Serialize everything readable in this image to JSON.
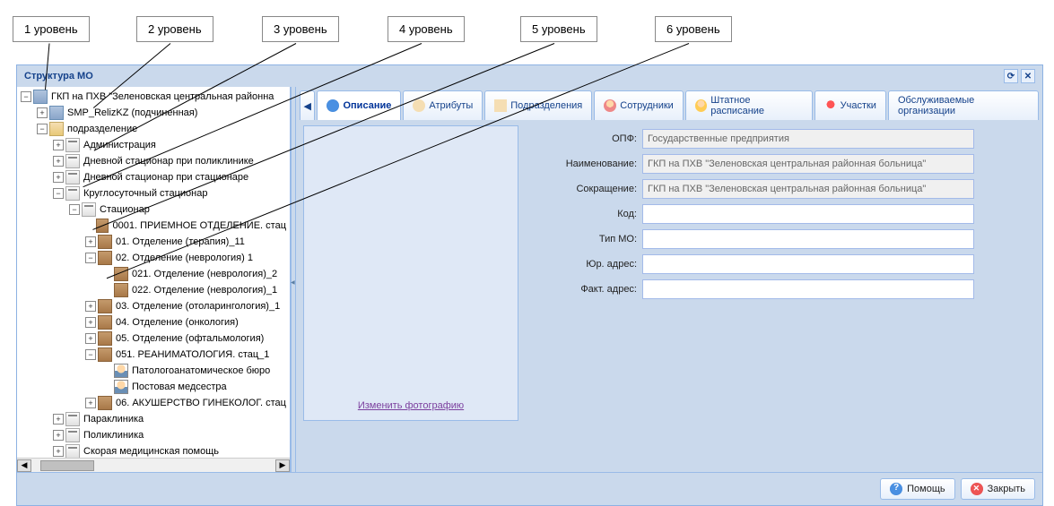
{
  "callouts": {
    "level1": "1 уровень",
    "level2": "2 уровень",
    "level3": "3 уровень",
    "level4": "4 уровень",
    "level5": "5 уровень",
    "level6": "6 уровень"
  },
  "window": {
    "title": "Структура МО"
  },
  "tree": {
    "root": "ГКП на ПХВ \"Зеленовская центральная районна",
    "items": [
      {
        "label": "SMP_RelizKZ (подчиненная)",
        "indent": 1,
        "icon": "building",
        "toggle": "+"
      },
      {
        "label": "подразделение",
        "indent": 1,
        "icon": "folder",
        "toggle": "-"
      },
      {
        "label": "Администрация",
        "indent": 2,
        "icon": "doc",
        "toggle": "+"
      },
      {
        "label": "Дневной стационар при поликлинике",
        "indent": 2,
        "icon": "doc",
        "toggle": "+"
      },
      {
        "label": "Дневной стационар при стационаре",
        "indent": 2,
        "icon": "doc",
        "toggle": "+"
      },
      {
        "label": "Круглосуточный стационар",
        "indent": 2,
        "icon": "doc",
        "toggle": "-"
      },
      {
        "label": "Стационар",
        "indent": 3,
        "icon": "doc",
        "toggle": "-"
      },
      {
        "label": "0001. ПРИЕМНОЕ ОТДЕЛЕНИЕ. стац",
        "indent": 4,
        "icon": "dept",
        "toggle": ""
      },
      {
        "label": "01. Отделение (терапия)_11",
        "indent": 4,
        "icon": "dept",
        "toggle": "+"
      },
      {
        "label": "02. Отделение (неврология) 1",
        "indent": 4,
        "icon": "dept",
        "toggle": "-"
      },
      {
        "label": "021. Отделение (неврология)_2",
        "indent": 5,
        "icon": "dept",
        "toggle": ""
      },
      {
        "label": "022. Отделение (неврология)_1",
        "indent": 5,
        "icon": "dept",
        "toggle": ""
      },
      {
        "label": "03. Отделение (отоларингология)_1",
        "indent": 4,
        "icon": "dept",
        "toggle": "+"
      },
      {
        "label": "04. Отделение (онкология)",
        "indent": 4,
        "icon": "dept",
        "toggle": "+"
      },
      {
        "label": "05. Отделение (офтальмология)",
        "indent": 4,
        "icon": "dept",
        "toggle": "+"
      },
      {
        "label": "051. РЕАНИМАТОЛОГИЯ. стац_1",
        "indent": 4,
        "icon": "dept",
        "toggle": "-"
      },
      {
        "label": "Патологоанатомическое бюро",
        "indent": 5,
        "icon": "person",
        "toggle": ""
      },
      {
        "label": "Постовая медсестра",
        "indent": 5,
        "icon": "person",
        "toggle": ""
      },
      {
        "label": "06. АКУШЕРСТВО ГИНЕКОЛОГ. стац",
        "indent": 4,
        "icon": "dept",
        "toggle": "+"
      },
      {
        "label": "Параклиника",
        "indent": 2,
        "icon": "doc",
        "toggle": "+"
      },
      {
        "label": "Поликлиника",
        "indent": 2,
        "icon": "doc",
        "toggle": "+"
      },
      {
        "label": "Скорая медицинская помощь",
        "indent": 2,
        "icon": "doc",
        "toggle": "+"
      }
    ]
  },
  "tabs": {
    "nav_prev": "◀",
    "description": "Описание",
    "attributes": "Атрибуты",
    "subdivisions": "Подразделения",
    "staff": "Сотрудники",
    "schedule": "Штатное расписание",
    "areas": "Участки",
    "served_orgs": "Обслуживаемые организации"
  },
  "form": {
    "labels": {
      "opf": "ОПФ:",
      "name": "Наименование:",
      "short": "Сокращение:",
      "code": "Код:",
      "mo_type": "Тип МО:",
      "legal_addr": "Юр. адрес:",
      "actual_addr": "Факт. адрес:"
    },
    "values": {
      "opf": "Государственные предприятия",
      "name": "ГКП на ПХВ \"Зеленовская центральная районная больница\"",
      "short": "ГКП на ПХВ \"Зеленовская центральная районная больница\"",
      "code": "",
      "mo_type": "",
      "legal_addr": "",
      "actual_addr": ""
    }
  },
  "photo": {
    "change_link": "Изменить фотографию"
  },
  "footer": {
    "help": "Помощь",
    "close": "Закрыть"
  }
}
